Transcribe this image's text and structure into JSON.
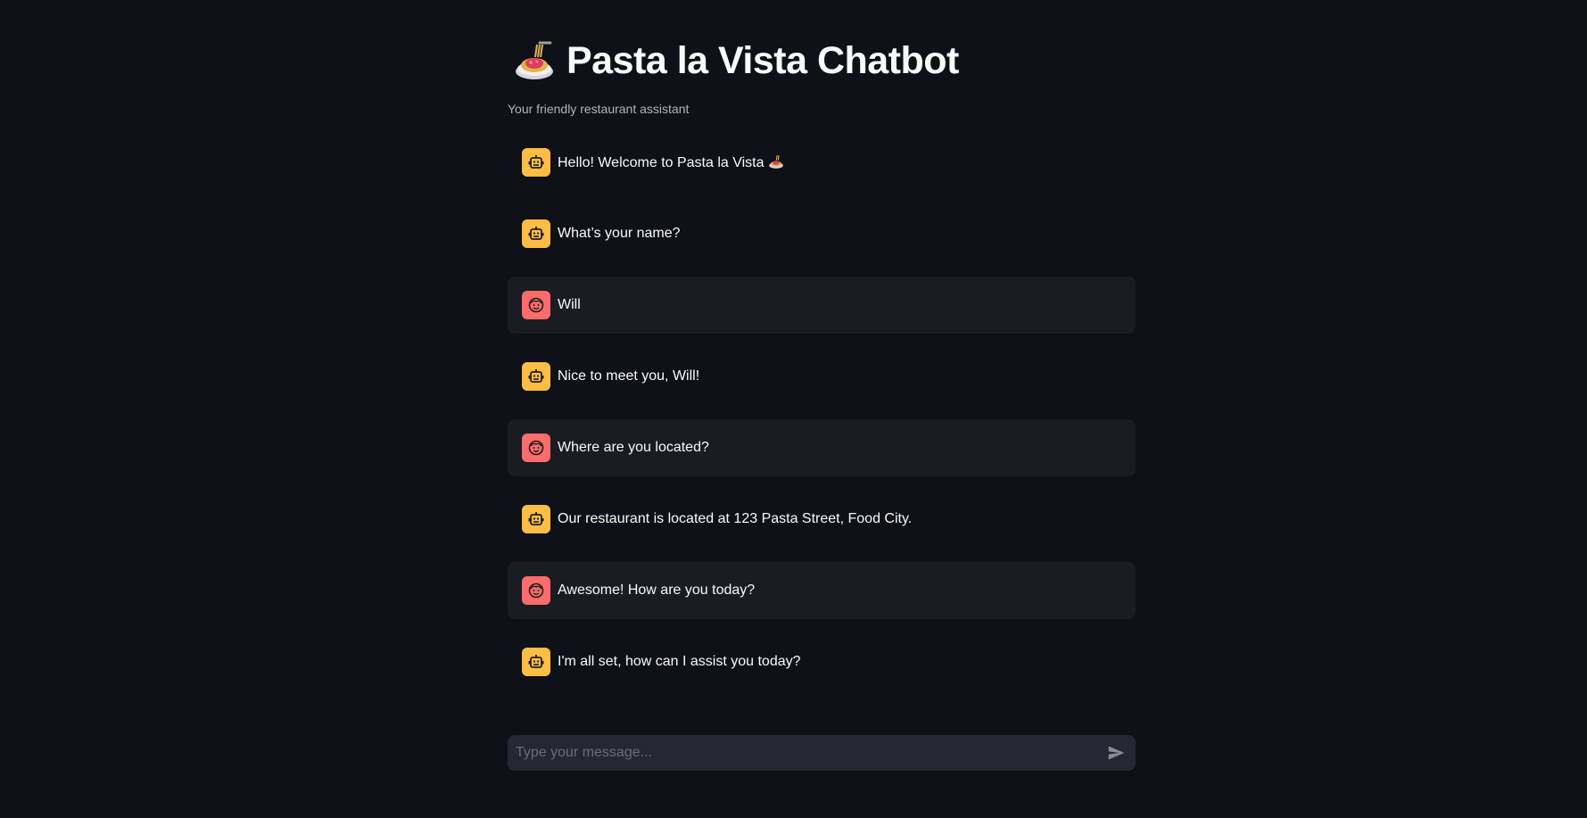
{
  "header": {
    "title": "Pasta la Vista Chatbot",
    "title_icon": "spaghetti-emoji",
    "subtitle": "Your friendly restaurant assistant"
  },
  "messages": [
    {
      "role": "assistant",
      "avatar_icon": "robot-icon",
      "text": "Hello! Welcome to Pasta la Vista",
      "trailing_icon": "spaghetti-emoji"
    },
    {
      "role": "assistant",
      "avatar_icon": "robot-icon",
      "text": "What’s your name?"
    },
    {
      "role": "user",
      "avatar_icon": "smiley-face-icon",
      "text": "Will"
    },
    {
      "role": "assistant",
      "avatar_icon": "robot-icon",
      "text": "Nice to meet you, Will!"
    },
    {
      "role": "user",
      "avatar_icon": "smiley-face-icon",
      "text": "Where are you located?"
    },
    {
      "role": "assistant",
      "avatar_icon": "robot-icon",
      "text": "Our restaurant is located at 123 Pasta Street, Food City."
    },
    {
      "role": "user",
      "avatar_icon": "smiley-face-icon",
      "text": "Awesome! How are you today?"
    },
    {
      "role": "assistant",
      "avatar_icon": "robot-icon",
      "text": "I'm all set, how can I assist you today?"
    }
  ],
  "chat_input": {
    "placeholder": "Type your message...",
    "value": "",
    "send_icon": "send-icon"
  },
  "colors": {
    "background": "#0e1117",
    "assistant_avatar": "#ffbd45",
    "user_avatar": "#ff6c6c",
    "user_message_bg": "#1a1c24",
    "input_bg": "#262730"
  }
}
